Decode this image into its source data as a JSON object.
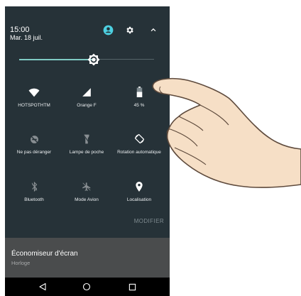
{
  "status": {
    "time": "15:00",
    "date": "Mar. 18 juil."
  },
  "brightness": {
    "level": 0.55
  },
  "tiles": [
    {
      "label": "HOTSPOTHTM",
      "icon": "wifi-icon"
    },
    {
      "label": "Orange F",
      "icon": "signal-icon"
    },
    {
      "label": "45 %",
      "icon": "battery-icon"
    },
    {
      "label": "Ne pas déranger",
      "icon": "do-not-disturb-off-icon"
    },
    {
      "label": "Lampe de poche",
      "icon": "flashlight-off-icon"
    },
    {
      "label": "Rotation automatique",
      "icon": "auto-rotate-icon"
    },
    {
      "label": "Bluetooth",
      "icon": "bluetooth-off-icon"
    },
    {
      "label": "Mode Avion",
      "icon": "airplane-mode-icon"
    },
    {
      "label": "Localisation",
      "icon": "location-icon"
    }
  ],
  "modifier_label": "MODIFIER",
  "notification": {
    "title": "Économiseur d'écran",
    "subtitle": "Horloge"
  },
  "colors": {
    "panel": "#263238",
    "accent": "#80cbc4",
    "user": "#4dd0e1"
  }
}
